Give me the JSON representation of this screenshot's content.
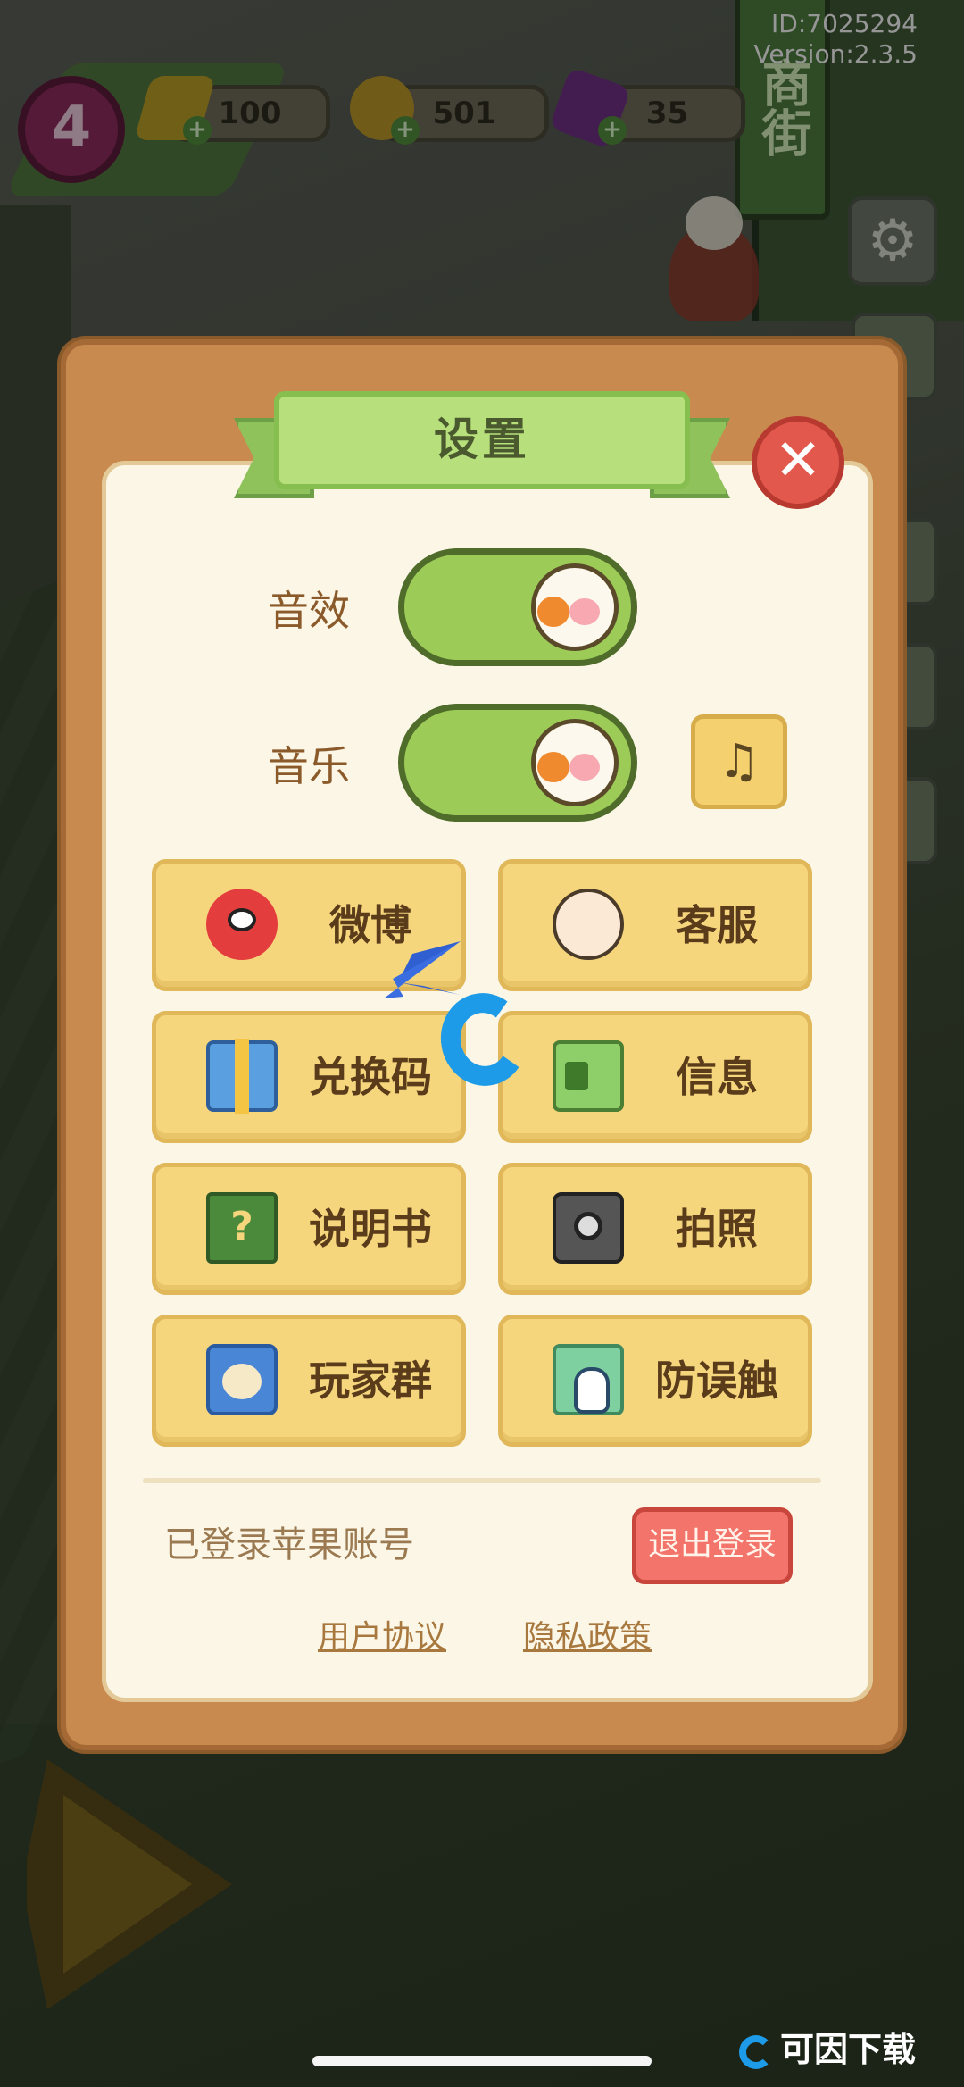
{
  "header": {
    "player_id": "ID:7025294",
    "version": "Version:2.3.5",
    "level": "4",
    "energy": "100",
    "coins": "501",
    "gems": "35"
  },
  "scene": {
    "store_sign": "商街"
  },
  "settings": {
    "title": "设置",
    "close_symbol": "✕",
    "sound_effect_label": "音效",
    "music_label": "音乐",
    "music_list_symbol": "♫",
    "buttons": [
      {
        "label": "微博",
        "icon": "weibo-icon"
      },
      {
        "label": "客服",
        "icon": "customer-service-icon"
      },
      {
        "label": "兑换码",
        "icon": "gift-icon"
      },
      {
        "label": "信息",
        "icon": "id-card-icon"
      },
      {
        "label": "说明书",
        "icon": "book-icon",
        "glyph": "?"
      },
      {
        "label": "拍照",
        "icon": "camera-icon"
      },
      {
        "label": "玩家群",
        "icon": "group-icon"
      },
      {
        "label": "防误触",
        "icon": "touch-icon"
      }
    ],
    "login_status": "已登录苹果账号",
    "logout_label": "退出登录",
    "user_agreement": "用户协议",
    "privacy_policy": "隐私政策"
  },
  "watermark": {
    "brand": "可因下载"
  },
  "colors": {
    "panel_frame": "#c98a4f",
    "panel_paper": "#fbf6e6",
    "ribbon_green": "#b7e07c",
    "toggle_green": "#9ccc57",
    "button_yellow": "#f6d67d",
    "close_red": "#e3584d",
    "logout_red": "#f3746b"
  }
}
